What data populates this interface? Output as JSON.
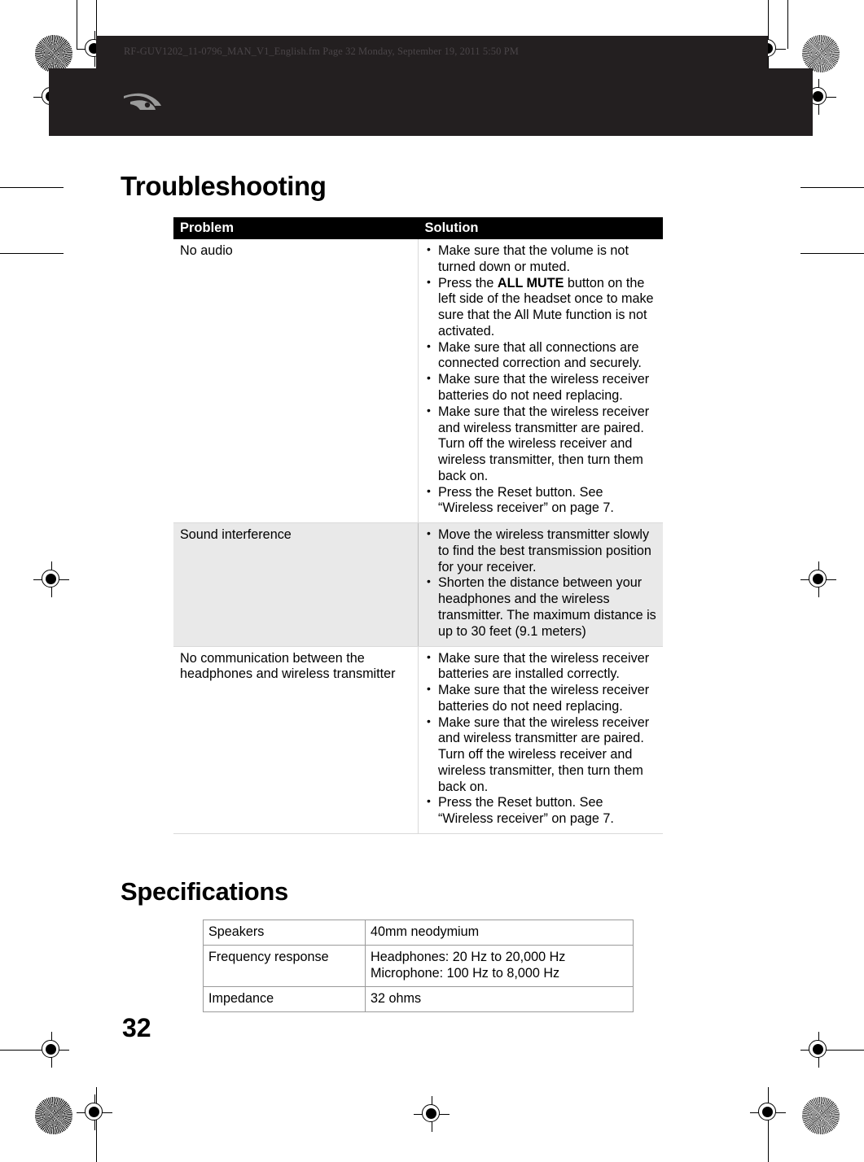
{
  "document": {
    "filename_header": "RF-GUV1202_11-0796_MAN_V1_English.fm  Page 32  Monday, September 19, 2011  5:50 PM",
    "page_number": "32",
    "logo_name": "rocketfish-logo"
  },
  "troubleshooting": {
    "heading": "Troubleshooting",
    "columns": {
      "problem": "Problem",
      "solution": "Solution"
    },
    "rows": [
      {
        "problem": "No audio",
        "shaded": false,
        "solutions": [
          {
            "pre": "Make sure that the volume is not turned down or muted.",
            "bold": "",
            "post": ""
          },
          {
            "pre": "Press the ",
            "bold": "ALL MUTE",
            "post": " button on the left side of the headset once to make sure that the All Mute function is not activated."
          },
          {
            "pre": "Make sure that all connections are connected correction and securely.",
            "bold": "",
            "post": ""
          },
          {
            "pre": "Make sure that the wireless receiver batteries do not need replacing.",
            "bold": "",
            "post": ""
          },
          {
            "pre": "Make sure that the wireless receiver and wireless transmitter are paired. Turn off the wireless receiver and wireless transmitter, then turn them back on.",
            "bold": "",
            "post": ""
          },
          {
            "pre": "Press the Reset button. See “Wireless receiver” on page 7.",
            "bold": "",
            "post": ""
          }
        ]
      },
      {
        "problem": "Sound interference",
        "shaded": true,
        "solutions": [
          {
            "pre": "Move the wireless transmitter slowly to find the best transmission position for your receiver.",
            "bold": "",
            "post": ""
          },
          {
            "pre": "Shorten the distance between your headphones and the wireless transmitter. The maximum distance is up to 30 feet (9.1 meters)",
            "bold": "",
            "post": ""
          }
        ]
      },
      {
        "problem": "No communication between the headphones and wireless transmitter",
        "shaded": false,
        "solutions": [
          {
            "pre": "Make sure that the wireless receiver batteries are installed correctly.",
            "bold": "",
            "post": ""
          },
          {
            "pre": "Make sure that the wireless receiver batteries do not need replacing.",
            "bold": "",
            "post": ""
          },
          {
            "pre": "Make sure that the wireless receiver and wireless transmitter are paired. Turn off the wireless receiver and wireless transmitter, then turn them back on.",
            "bold": "",
            "post": ""
          },
          {
            "pre": "Press the Reset button. See “Wireless receiver” on page 7.",
            "bold": "",
            "post": ""
          }
        ]
      }
    ]
  },
  "specifications": {
    "heading": "Specifications",
    "rows": [
      {
        "key": "Speakers",
        "value": "40mm neodymium",
        "value2": ""
      },
      {
        "key": "Frequency response",
        "value": "Headphones: 20 Hz to 20,000 Hz",
        "value2": "Microphone: 100 Hz to 8,000 Hz"
      },
      {
        "key": "Impedance",
        "value": "32 ohms",
        "value2": ""
      }
    ]
  },
  "colors": {
    "header_band": "#231f20",
    "table_header": "#000000",
    "shaded_row": "#e9e9e9",
    "border": "#9a9a9a"
  }
}
